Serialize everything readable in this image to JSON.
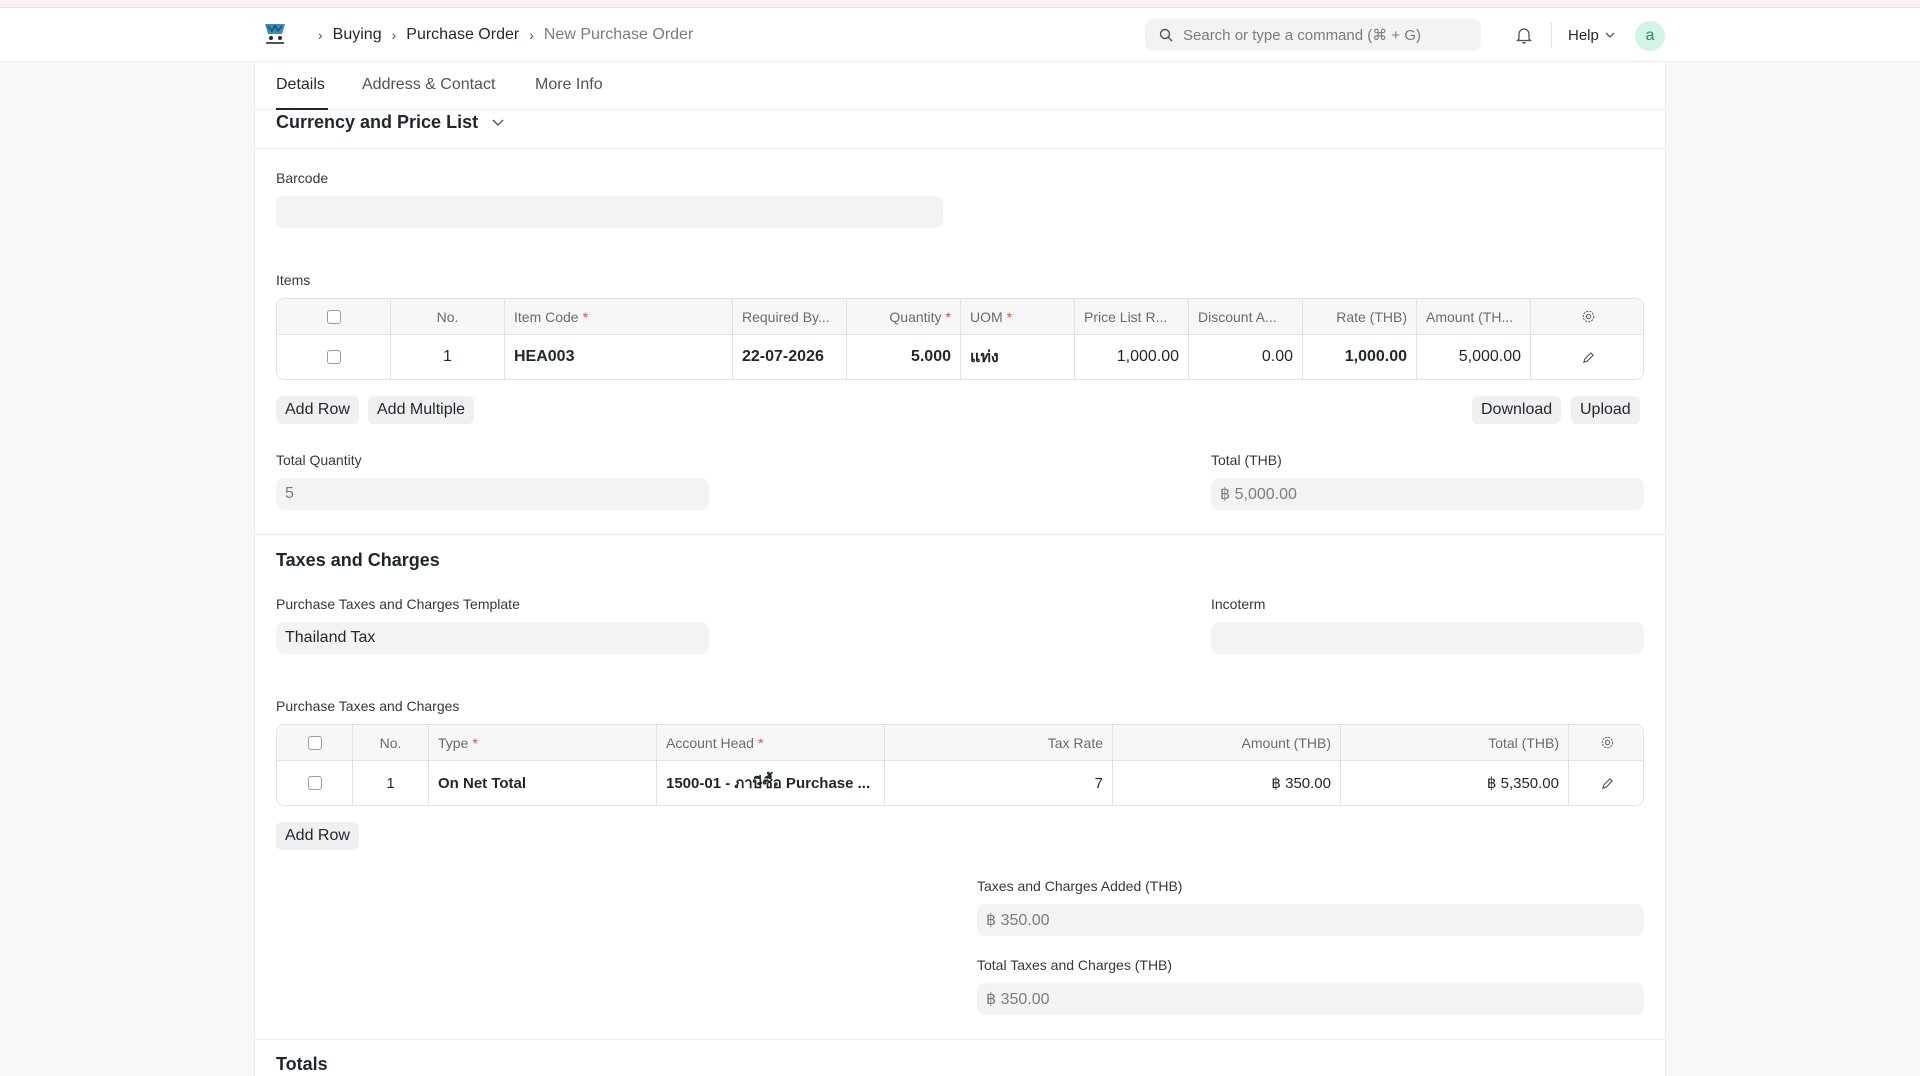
{
  "navbar": {
    "breadcrumbs": [
      "Buying",
      "Purchase Order",
      "New Purchase Order"
    ],
    "search_placeholder": "Search or type a command (⌘ + G)",
    "help_label": "Help",
    "avatar_initial": "a"
  },
  "tabs": [
    "Details",
    "Address & Contact",
    "More Info"
  ],
  "currency_section": {
    "title": "Currency and Price List"
  },
  "barcode": {
    "label": "Barcode",
    "value": ""
  },
  "items": {
    "label": "Items",
    "columns": [
      "No.",
      "Item Code",
      "Required By...",
      "Quantity",
      "UOM",
      "Price List R...",
      "Discount A...",
      "Rate (THB)",
      "Amount (TH..."
    ],
    "required_marker": "*",
    "rows": [
      {
        "no": "1",
        "item_code": "HEA003",
        "required_by": "22-07-2026",
        "quantity": "5.000",
        "uom": "แท่ง",
        "price_list_rate": "1,000.00",
        "discount_amount": "0.00",
        "rate": "1,000.00",
        "amount": "5,000.00"
      }
    ],
    "add_row": "Add Row",
    "add_multiple": "Add Multiple",
    "download": "Download",
    "upload": "Upload"
  },
  "totals_top": {
    "total_quantity_label": "Total Quantity",
    "total_quantity_value": "5",
    "total_label": "Total (THB)",
    "total_value": "฿ 5,000.00"
  },
  "taxes": {
    "title": "Taxes and Charges",
    "template_label": "Purchase Taxes and Charges Template",
    "template_value": "Thailand Tax",
    "incoterm_label": "Incoterm",
    "incoterm_value": "",
    "table_label": "Purchase Taxes and Charges",
    "columns": [
      "No.",
      "Type",
      "Account Head",
      "Tax Rate",
      "Amount (THB)",
      "Total (THB)"
    ],
    "rows": [
      {
        "no": "1",
        "type": "On Net Total",
        "account_head": "1500-01 - ภาษีซื้อ Purchase ...",
        "tax_rate": "7",
        "amount": "฿ 350.00",
        "total": "฿ 5,350.00"
      }
    ],
    "add_row": "Add Row",
    "added_label": "Taxes and Charges Added (THB)",
    "added_value": "฿ 350.00",
    "total_label": "Total Taxes and Charges (THB)",
    "total_value": "฿ 350.00"
  },
  "totals_section": {
    "title": "Totals"
  }
}
